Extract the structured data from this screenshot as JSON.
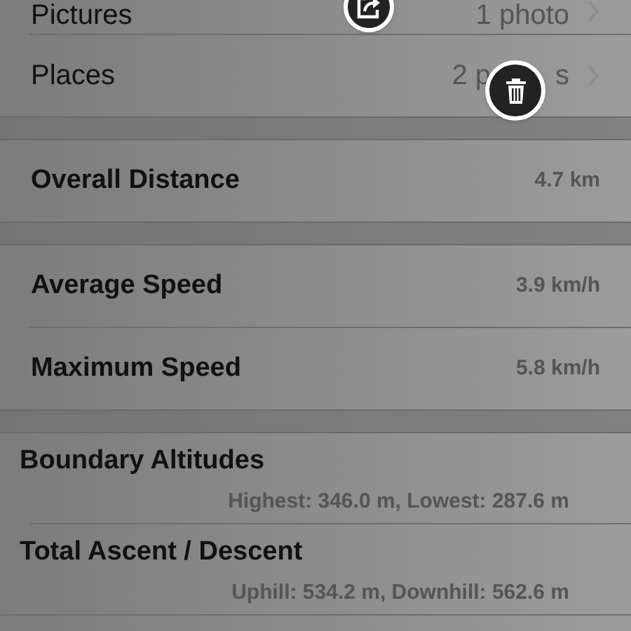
{
  "sections": [
    {
      "rows": [
        {
          "kind": "link",
          "label": "Pictures",
          "value": "1 photo"
        },
        {
          "kind": "link",
          "label": "Places",
          "value": "2 p",
          "value_end": "s"
        }
      ]
    },
    {
      "rows": [
        {
          "kind": "stat",
          "label": "Overall Distance",
          "value": "4.7 km"
        }
      ]
    },
    {
      "rows": [
        {
          "kind": "stat",
          "label": "Average Speed",
          "value": "3.9 km/h"
        },
        {
          "kind": "stat",
          "label": "Maximum Speed",
          "value": "5.8 km/h"
        }
      ]
    },
    {
      "rows": [
        {
          "kind": "detail",
          "label": "Boundary Altitudes",
          "value": "Highest: 346.0 m, Lowest: 287.6 m"
        },
        {
          "kind": "detail",
          "label": "Total Ascent / Descent",
          "value": "Uphill: 534.2 m, Downhill: 562.6 m"
        }
      ]
    }
  ],
  "overlay_buttons": [
    {
      "kind": "share"
    },
    {
      "kind": "delete"
    }
  ]
}
